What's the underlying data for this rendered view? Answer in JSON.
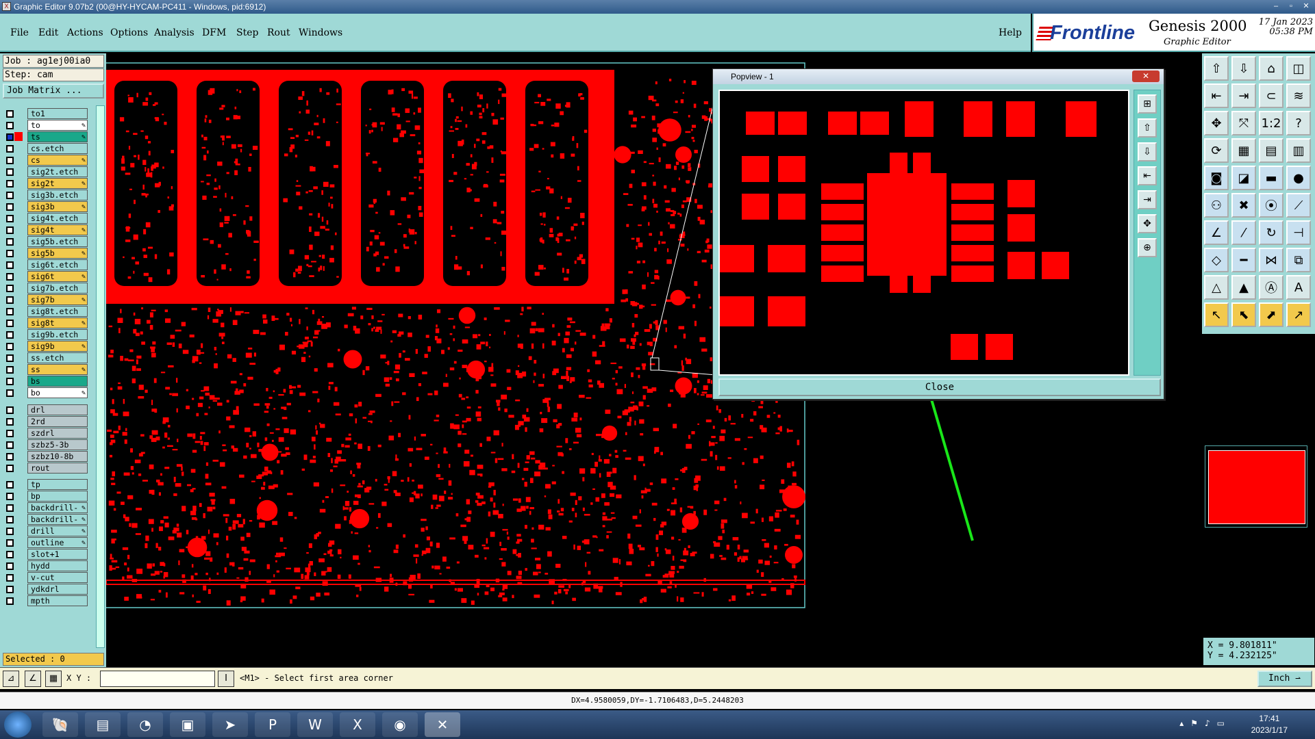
{
  "window": {
    "title": "Graphic Editor 9.07b2 (00@HY-HYCAM-PC411 - Windows, pid:6912)",
    "controls": [
      "–",
      "▫",
      "✕"
    ]
  },
  "menu": [
    "File",
    "Edit",
    "Actions",
    "Options",
    "Analysis",
    "DFM",
    "Step",
    "Rout",
    "Windows"
  ],
  "help": "Help",
  "logo": {
    "brand": "Frontline",
    "product": "Genesis 2000",
    "subtitle": "Graphic Editor",
    "date": "17 Jan 2023",
    "time": "05:38 PM"
  },
  "job": {
    "job_line": "Job : ag1ej00ia0",
    "step_line": "Step: cam",
    "matrix_button": "Job Matrix ..."
  },
  "layers": [
    {
      "name": "to1",
      "color": "#9fd9d6",
      "pen": false
    },
    {
      "name": "to",
      "color": "#ffffff",
      "pen": true
    },
    {
      "name": "ts",
      "color": "#1aa88a",
      "pen": true,
      "active": true
    },
    {
      "name": "cs.etch",
      "color": "#9fd9d6",
      "pen": false
    },
    {
      "name": "cs",
      "color": "#f2c94c",
      "pen": true
    },
    {
      "name": "sig2t.etch",
      "color": "#9fd9d6",
      "pen": false
    },
    {
      "name": "sig2t",
      "color": "#f2c94c",
      "pen": true
    },
    {
      "name": "sig3b.etch",
      "color": "#9fd9d6",
      "pen": false
    },
    {
      "name": "sig3b",
      "color": "#f2c94c",
      "pen": true
    },
    {
      "name": "sig4t.etch",
      "color": "#9fd9d6",
      "pen": false
    },
    {
      "name": "sig4t",
      "color": "#f2c94c",
      "pen": true
    },
    {
      "name": "sig5b.etch",
      "color": "#9fd9d6",
      "pen": false
    },
    {
      "name": "sig5b",
      "color": "#f2c94c",
      "pen": true
    },
    {
      "name": "sig6t.etch",
      "color": "#9fd9d6",
      "pen": false
    },
    {
      "name": "sig6t",
      "color": "#f2c94c",
      "pen": true
    },
    {
      "name": "sig7b.etch",
      "color": "#9fd9d6",
      "pen": false
    },
    {
      "name": "sig7b",
      "color": "#f2c94c",
      "pen": true
    },
    {
      "name": "sig8t.etch",
      "color": "#9fd9d6",
      "pen": false
    },
    {
      "name": "sig8t",
      "color": "#f2c94c",
      "pen": true
    },
    {
      "name": "sig9b.etch",
      "color": "#9fd9d6",
      "pen": false
    },
    {
      "name": "sig9b",
      "color": "#f2c94c",
      "pen": true
    },
    {
      "name": "ss.etch",
      "color": "#9fd9d6",
      "pen": false
    },
    {
      "name": "ss",
      "color": "#f2c94c",
      "pen": true
    },
    {
      "name": "bs",
      "color": "#1aa88a",
      "pen": false
    },
    {
      "name": "bo",
      "color": "#ffffff",
      "pen": true
    },
    {
      "name": "drl",
      "color": "#b8c8cc",
      "pen": false,
      "gap": true
    },
    {
      "name": "2rd",
      "color": "#b8c8cc",
      "pen": false
    },
    {
      "name": "szdrl",
      "color": "#b8c8cc",
      "pen": false
    },
    {
      "name": "szbz5-3b",
      "color": "#b8c8cc",
      "pen": false
    },
    {
      "name": "szbz10-8b",
      "color": "#b8c8cc",
      "pen": false
    },
    {
      "name": "rout",
      "color": "#b8c8cc",
      "pen": false
    },
    {
      "name": "tp",
      "color": "#9fd9d6",
      "pen": false,
      "gap": true
    },
    {
      "name": "bp",
      "color": "#9fd9d6",
      "pen": false
    },
    {
      "name": "backdrill-",
      "color": "#9fd9d6",
      "pen": true
    },
    {
      "name": "backdrill-",
      "color": "#9fd9d6",
      "pen": true
    },
    {
      "name": "drill",
      "color": "#9fd9d6",
      "pen": true
    },
    {
      "name": "outline",
      "color": "#9fd9d6",
      "pen": true
    },
    {
      "name": "slot+1",
      "color": "#9fd9d6",
      "pen": false
    },
    {
      "name": "hydd",
      "color": "#9fd9d6",
      "pen": false
    },
    {
      "name": "v-cut",
      "color": "#9fd9d6",
      "pen": false
    },
    {
      "name": "ydkdrl",
      "color": "#9fd9d6",
      "pen": false
    },
    {
      "name": "mpth",
      "color": "#9fd9d6",
      "pen": false
    }
  ],
  "selected": "Selected : 0",
  "popview": {
    "title": "Popview - 1",
    "close_button": "Close",
    "titlebar_close": "✕"
  },
  "coords": {
    "x": "X = 9.801811\"",
    "y": "Y = 4.232125\""
  },
  "cmdline": {
    "xy_label": "X Y :",
    "input_value": "",
    "prompt": "<M1> - Select first area corner",
    "units": "Inch"
  },
  "statusbar": {
    "text": "DX=4.9580059,DY=-1.7106483,D=5.2448203"
  },
  "taskbar": {
    "time": "17:41",
    "date": "2023/1/17"
  },
  "colors": {
    "copper": "#ff0000",
    "panel": "#9fd9d6",
    "annotation_arrow": "#19e619"
  }
}
